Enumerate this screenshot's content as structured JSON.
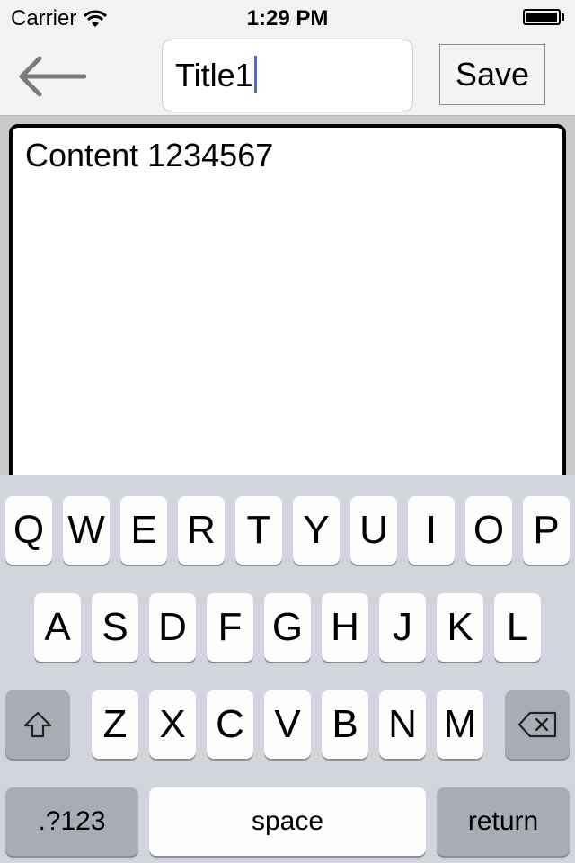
{
  "status_bar": {
    "carrier": "Carrier",
    "time": "1:29 PM"
  },
  "nav": {
    "back_icon": "back-arrow-icon",
    "title_value": "Title1",
    "save_label": "Save"
  },
  "content": {
    "text": "Content 1234567"
  },
  "keyboard": {
    "row1": [
      "Q",
      "W",
      "E",
      "R",
      "T",
      "Y",
      "U",
      "I",
      "O",
      "P"
    ],
    "row2": [
      "A",
      "S",
      "D",
      "F",
      "G",
      "H",
      "J",
      "K",
      "L"
    ],
    "row3": [
      "Z",
      "X",
      "C",
      "V",
      "B",
      "N",
      "M"
    ],
    "numbers_label": ".?123",
    "space_label": "space",
    "return_label": "return"
  },
  "colors": {
    "caret": "#3b6de0",
    "keyboard_bg": "#d1d5db",
    "key_gray": "#a8adb5"
  }
}
